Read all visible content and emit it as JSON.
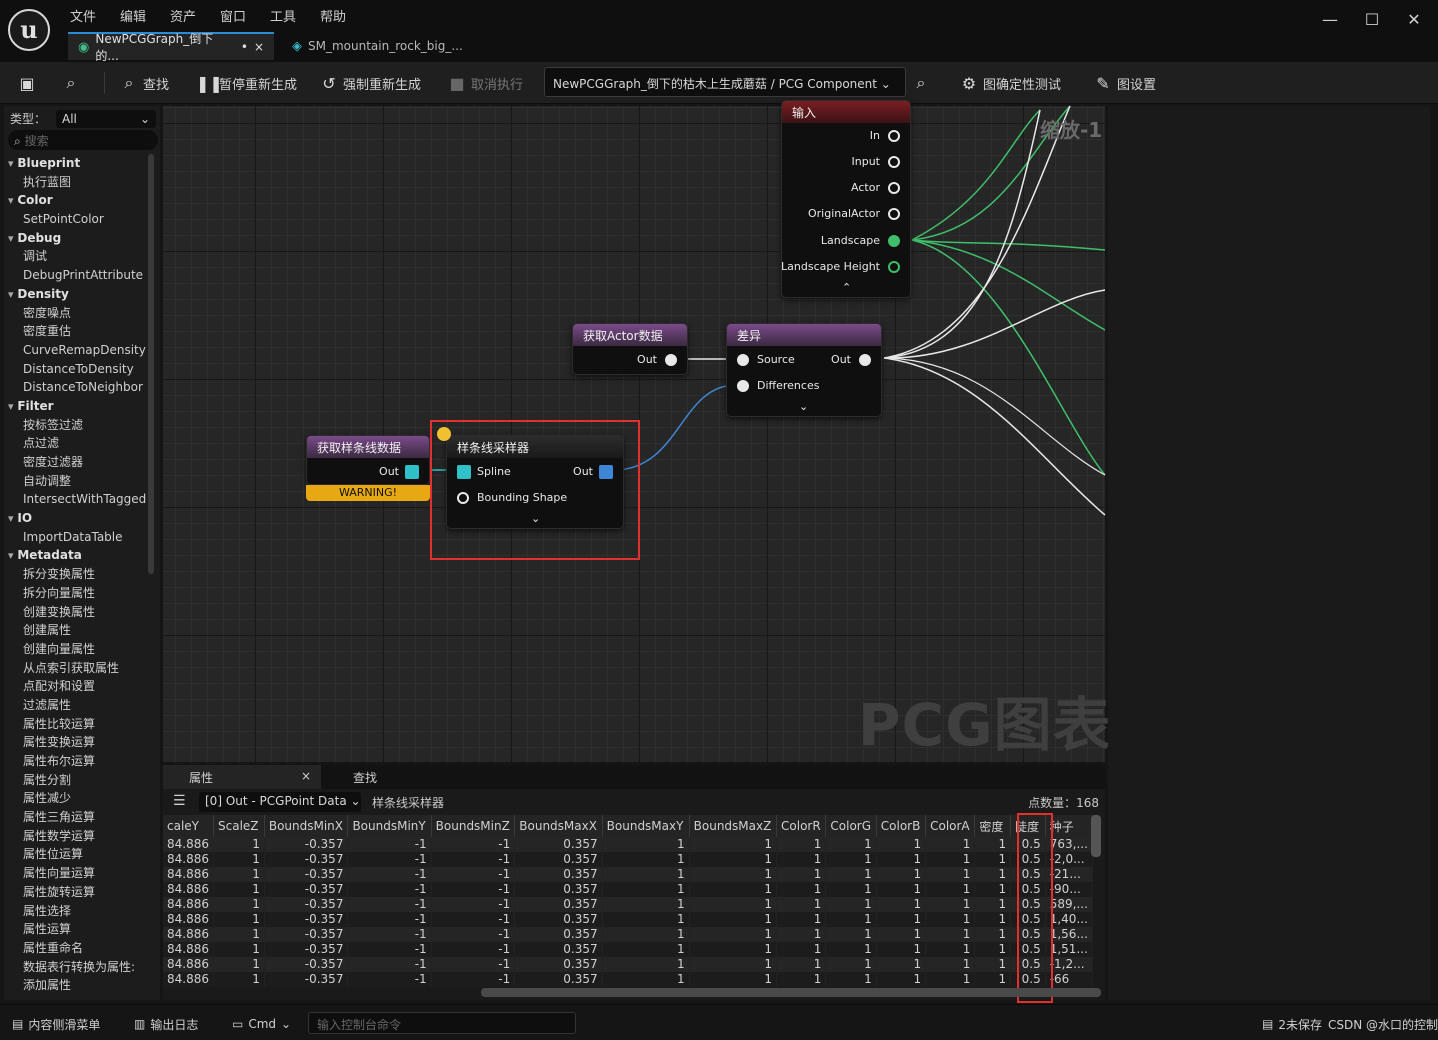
{
  "menu": [
    "文件",
    "编辑",
    "资产",
    "窗口",
    "工具",
    "帮助"
  ],
  "tabs": [
    {
      "label": "NewPCGGraph_倒下的...",
      "modified": "•",
      "close": "×"
    },
    {
      "label": "SM_mountain_rock_big_..."
    }
  ],
  "toolbar": {
    "find": "查找",
    "pause_regen": "暂停重新生成",
    "force_regen": "强制重新生成",
    "cancel_exec": "取消执行",
    "path": "NewPCGGraph_倒下的枯木上生成蘑菇 / PCG Component",
    "determinism": "图确定性测试",
    "graph_settings": "图设置"
  },
  "palette": {
    "type_label": "类型：",
    "type_value": "All",
    "search_placeholder": "搜索",
    "tree": [
      {
        "kind": "cat",
        "label": "Blueprint"
      },
      {
        "kind": "leaf",
        "label": "执行蓝图"
      },
      {
        "kind": "cat",
        "label": "Color"
      },
      {
        "kind": "leaf",
        "label": "SetPointColor"
      },
      {
        "kind": "cat",
        "label": "Debug"
      },
      {
        "kind": "leaf",
        "label": "调试"
      },
      {
        "kind": "leaf",
        "label": "DebugPrintAttribute"
      },
      {
        "kind": "cat",
        "label": "Density"
      },
      {
        "kind": "leaf",
        "label": "密度噪点"
      },
      {
        "kind": "leaf",
        "label": "密度重估"
      },
      {
        "kind": "leaf",
        "label": "CurveRemapDensity"
      },
      {
        "kind": "leaf",
        "label": "DistanceToDensity"
      },
      {
        "kind": "leaf",
        "label": "DistanceToNeighbor"
      },
      {
        "kind": "cat",
        "label": "Filter"
      },
      {
        "kind": "leaf",
        "label": "按标签过滤"
      },
      {
        "kind": "leaf",
        "label": "点过滤"
      },
      {
        "kind": "leaf",
        "label": "密度过滤器"
      },
      {
        "kind": "leaf",
        "label": "自动调整"
      },
      {
        "kind": "leaf",
        "label": "IntersectWithTagged"
      },
      {
        "kind": "cat",
        "label": "IO"
      },
      {
        "kind": "leaf",
        "label": "ImportDataTable"
      },
      {
        "kind": "cat",
        "label": "Metadata"
      },
      {
        "kind": "leaf",
        "label": "拆分变换属性"
      },
      {
        "kind": "leaf",
        "label": "拆分向量属性"
      },
      {
        "kind": "leaf",
        "label": "创建变换属性"
      },
      {
        "kind": "leaf",
        "label": "创建属性"
      },
      {
        "kind": "leaf",
        "label": "创建向量属性"
      },
      {
        "kind": "leaf",
        "label": "从点索引获取属性"
      },
      {
        "kind": "leaf",
        "label": "点配对和设置"
      },
      {
        "kind": "leaf",
        "label": "过滤属性"
      },
      {
        "kind": "leaf",
        "label": "属性比较运算"
      },
      {
        "kind": "leaf",
        "label": "属性变换运算"
      },
      {
        "kind": "leaf",
        "label": "属性布尔运算"
      },
      {
        "kind": "leaf",
        "label": "属性分割"
      },
      {
        "kind": "leaf",
        "label": "属性减少"
      },
      {
        "kind": "leaf",
        "label": "属性三角运算"
      },
      {
        "kind": "leaf",
        "label": "属性数学运算"
      },
      {
        "kind": "leaf",
        "label": "属性位运算"
      },
      {
        "kind": "leaf",
        "label": "属性向量运算"
      },
      {
        "kind": "leaf",
        "label": "属性旋转运算"
      },
      {
        "kind": "leaf",
        "label": "属性选择"
      },
      {
        "kind": "leaf",
        "label": "属性运算"
      },
      {
        "kind": "leaf",
        "label": "属性重命名"
      },
      {
        "kind": "leaf",
        "label": "数据表行转换为属性:"
      },
      {
        "kind": "leaf",
        "label": "添加属性"
      }
    ]
  },
  "graph": {
    "zoom": "缩放-1",
    "watermark": "PCG图表",
    "input_node": {
      "title": "输入",
      "pins": [
        "In",
        "Input",
        "Actor",
        "OriginalActor",
        "Landscape",
        "Landscape Height"
      ]
    },
    "get_actor_node": {
      "title": "获取Actor数据",
      "out": "Out"
    },
    "diff_node": {
      "title": "差异",
      "source": "Source",
      "differences": "Differences",
      "out": "Out"
    },
    "get_spline_node": {
      "title": "获取样条线数据",
      "out": "Out",
      "warning": "WARNING!"
    },
    "spline_sampler_node": {
      "title": "样条线采样器",
      "spline": "Spline",
      "bounding": "Bounding Shape",
      "out": "Out"
    }
  },
  "details": {
    "tabs": [
      "属性",
      "查找"
    ],
    "tab_close": "×",
    "out_select": "[0] Out - PCGPoint Data",
    "node_name": "样条线采样器",
    "point_count": "点数量：168",
    "columns": [
      "caleY",
      "ScaleZ",
      "BoundsMinX",
      "BoundsMinY",
      "BoundsMinZ",
      "BoundsMaxX",
      "BoundsMaxY",
      "BoundsMaxZ",
      "ColorR",
      "ColorG",
      "ColorB",
      "ColorA",
      "密度",
      "陡度",
      "种子"
    ],
    "rows": [
      [
        "84.886",
        "1",
        "-0.357",
        "-1",
        "-1",
        "0.357",
        "1",
        "1",
        "1",
        "1",
        "1",
        "1",
        "1",
        "0.5",
        "763,..."
      ],
      [
        "84.886",
        "1",
        "-0.357",
        "-1",
        "-1",
        "0.357",
        "1",
        "1",
        "1",
        "1",
        "1",
        "1",
        "1",
        "0.5",
        "-2,0..."
      ],
      [
        "84.886",
        "1",
        "-0.357",
        "-1",
        "-1",
        "0.357",
        "1",
        "1",
        "1",
        "1",
        "1",
        "1",
        "1",
        "0.5",
        "-21..."
      ],
      [
        "84.886",
        "1",
        "-0.357",
        "-1",
        "-1",
        "0.357",
        "1",
        "1",
        "1",
        "1",
        "1",
        "1",
        "1",
        "0.5",
        "-90..."
      ],
      [
        "84.886",
        "1",
        "-0.357",
        "-1",
        "-1",
        "0.357",
        "1",
        "1",
        "1",
        "1",
        "1",
        "1",
        "1",
        "0.5",
        "589,..."
      ],
      [
        "84.886",
        "1",
        "-0.357",
        "-1",
        "-1",
        "0.357",
        "1",
        "1",
        "1",
        "1",
        "1",
        "1",
        "1",
        "0.5",
        "1,40..."
      ],
      [
        "84.886",
        "1",
        "-0.357",
        "-1",
        "-1",
        "0.357",
        "1",
        "1",
        "1",
        "1",
        "1",
        "1",
        "1",
        "0.5",
        "1,56..."
      ],
      [
        "84.886",
        "1",
        "-0.357",
        "-1",
        "-1",
        "0.357",
        "1",
        "1",
        "1",
        "1",
        "1",
        "1",
        "1",
        "0.5",
        "1,51..."
      ],
      [
        "84.886",
        "1",
        "-0.357",
        "-1",
        "-1",
        "0.357",
        "1",
        "1",
        "1",
        "1",
        "1",
        "1",
        "1",
        "0.5",
        "-1,2..."
      ],
      [
        "84.886",
        "1",
        "-0.357",
        "-1",
        "-1",
        "0.357",
        "1",
        "1",
        "1",
        "1",
        "1",
        "1",
        "1",
        "0.5",
        "-66"
      ]
    ]
  },
  "statusbar": {
    "content_drawer": "内容侧滑菜单",
    "output_log": "输出日志",
    "cmd": "Cmd",
    "console_placeholder": "输入控制台命令",
    "unsaved": "2未保存",
    "source_control": "CSDN @水口的控制"
  }
}
